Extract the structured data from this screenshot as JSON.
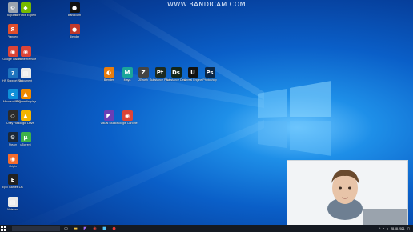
{
  "watermark": "WWW.BANDICAM.COM",
  "desktop_icons": [
    {
      "label": "Корзина",
      "icon": "recycle-bin-icon",
      "color": "#9aa4b0",
      "glyph": "♻"
    },
    {
      "label": "GeForce Experience",
      "icon": "geforce-icon",
      "color": "#76b900",
      "glyph": "◆"
    },
    {
      "label": "Bandicam",
      "icon": "bandicam-icon",
      "color": "#111111",
      "glyph": "●"
    },
    {
      "label": "Blender",
      "icon": "blender-icon",
      "color": "#c0392b",
      "glyph": "●"
    },
    {
      "label": "Yandex",
      "icon": "yandex-icon",
      "color": "#e04e2c",
      "glyph": "Я"
    },
    {
      "label": "Google Chrome",
      "icon": "chrome-icon",
      "color": "#db4437",
      "glyph": "◉"
    },
    {
      "label": "Chrome Remote",
      "icon": "chrome-icon",
      "color": "#db4437",
      "glyph": "◉"
    },
    {
      "label": "HP Support Assistant",
      "icon": "help-icon",
      "color": "#1e73be",
      "glyph": "?"
    },
    {
      "label": "Document",
      "icon": "document-icon",
      "color": "#e9e9e9",
      "glyph": "▤"
    },
    {
      "label": "Microsoft Edge",
      "icon": "edge-icon",
      "color": "#0f8fd8",
      "glyph": "e"
    },
    {
      "label": "VLC media player",
      "icon": "vlc-icon",
      "color": "#f08a00",
      "glyph": "▲"
    },
    {
      "label": "Unity Hub",
      "icon": "unity-icon",
      "color": "#2b2b2b",
      "glyph": "◇"
    },
    {
      "label": "Google Drive",
      "icon": "drive-icon",
      "color": "#f4b400",
      "glyph": "▲"
    },
    {
      "label": "Steam",
      "icon": "steam-icon",
      "color": "#1b2838",
      "glyph": "⚙"
    },
    {
      "label": "uTorrent",
      "icon": "utorrent-icon",
      "color": "#3eb249",
      "glyph": "µ"
    },
    {
      "label": "Origin",
      "icon": "origin-icon",
      "color": "#f56c2d",
      "glyph": "◉"
    },
    {
      "label": "Epic Games Launcher",
      "icon": "epic-icon",
      "color": "#222222",
      "glyph": "E"
    },
    {
      "label": "Notepad",
      "icon": "notepad-icon",
      "color": "#e9e9e9",
      "glyph": "▤"
    },
    {
      "label": "Blender",
      "icon": "blender-icon",
      "color": "#e87d0d",
      "glyph": "◐"
    },
    {
      "label": "Maya",
      "icon": "maya-icon",
      "color": "#1aa59b",
      "glyph": "M"
    },
    {
      "label": "ZBrush",
      "icon": "zbrush-icon",
      "color": "#444444",
      "glyph": "Z"
    },
    {
      "label": "Substance Painter",
      "icon": "painter-icon",
      "color": "#1d2b20",
      "glyph": "Pt"
    },
    {
      "label": "Substance Designer",
      "icon": "designer-icon",
      "color": "#12261a",
      "glyph": "Ds"
    },
    {
      "label": "Unreal Engine",
      "icon": "unreal-icon",
      "color": "#111111",
      "glyph": "U"
    },
    {
      "label": "Photoshop",
      "icon": "photoshop-icon",
      "color": "#0b2747",
      "glyph": "Ps"
    },
    {
      "label": "Visual Studio",
      "icon": "visual-studio-icon",
      "color": "#6a3fb5",
      "glyph": "◤"
    },
    {
      "label": "Google Chrome",
      "icon": "chrome-icon",
      "color": "#db4437",
      "glyph": "◉"
    }
  ],
  "taskbar": {
    "search_placeholder": "",
    "time": "",
    "date": "28.08.2021"
  }
}
